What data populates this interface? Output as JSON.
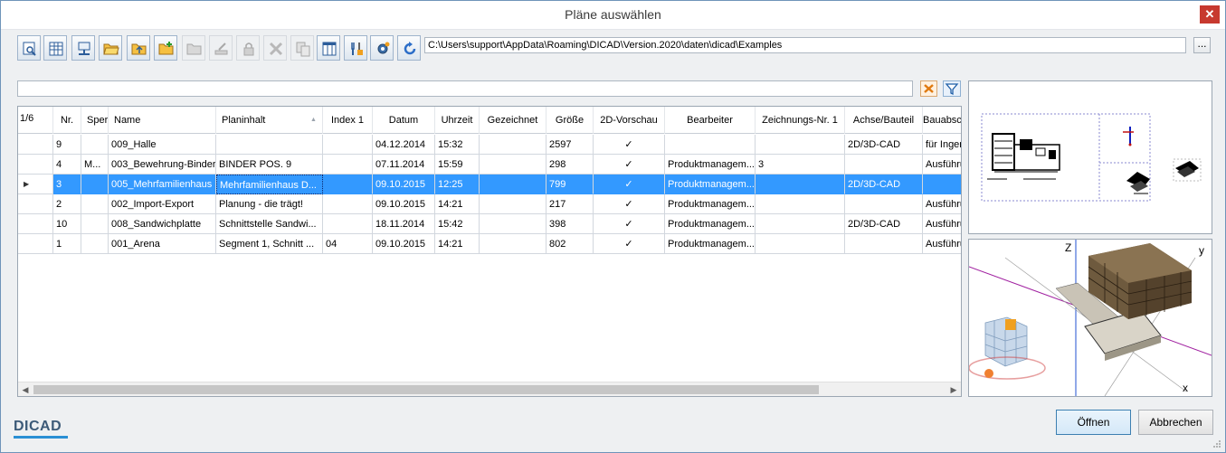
{
  "window": {
    "title": "Pläne auswählen",
    "close_label": "✕"
  },
  "toolbar": {
    "buttons": [
      {
        "icon": "preview-icon",
        "enabled": true
      },
      {
        "icon": "table-icon",
        "enabled": true
      },
      {
        "icon": "network-folder-icon",
        "enabled": true
      },
      {
        "icon": "open-folder-icon",
        "enabled": true
      },
      {
        "icon": "folder-up-icon",
        "enabled": true
      },
      {
        "icon": "new-folder-icon",
        "enabled": true
      },
      {
        "icon": "folder-open-disabled-icon",
        "enabled": false
      },
      {
        "icon": "edit-disabled-icon",
        "enabled": false
      },
      {
        "icon": "lock-disabled-icon",
        "enabled": false
      },
      {
        "icon": "delete-disabled-icon",
        "enabled": false
      },
      {
        "icon": "copy-disabled-icon",
        "enabled": false
      },
      {
        "icon": "columns-icon",
        "enabled": true
      },
      {
        "icon": "tools-icon",
        "enabled": true
      },
      {
        "icon": "settings-gear-icon",
        "enabled": true
      },
      {
        "icon": "refresh-icon",
        "enabled": true
      }
    ],
    "path": "C:\\Users\\support\\AppData\\Roaming\\DICAD\\Version.2020\\daten\\dicad\\Examples",
    "browse_label": "..."
  },
  "filter": {
    "value": ""
  },
  "grid": {
    "record_count": "1/6",
    "columns": [
      "Nr.",
      "Sperre",
      "Name",
      "Planinhalt",
      "Index 1",
      "Datum",
      "Uhrzeit",
      "Gezeichnet",
      "Größe",
      "2D-Vorschau",
      "Bearbeiter",
      "Zeichnungs-Nr. 1",
      "Achse/Bauteil",
      "Bauabschnitt"
    ],
    "sorted_column": "Planinhalt",
    "rows": [
      [
        "9",
        "",
        "009_Halle",
        "",
        "",
        "04.12.2014",
        "15:32",
        "",
        "2597",
        "✓",
        "",
        "",
        "2D/3D-CAD",
        "für Ingenieur"
      ],
      [
        "4",
        "M...",
        "003_Bewehrung-Binder",
        "BINDER POS. 9",
        "",
        "07.11.2014",
        "15:59",
        "",
        "298",
        "✓",
        "Produktmanagem...",
        "3",
        "",
        "Ausführung"
      ],
      [
        "3",
        "",
        "005_Mehrfamilienhaus",
        "Mehrfamilienhaus D...",
        "",
        "09.10.2015",
        "12:25",
        "",
        "799",
        "✓",
        "Produktmanagem...",
        "",
        "2D/3D-CAD",
        ""
      ],
      [
        "2",
        "",
        "002_Import-Export",
        "Planung - die trägt!",
        "",
        "09.10.2015",
        "14:21",
        "",
        "217",
        "✓",
        "Produktmanagem...",
        "",
        "",
        "Ausführung"
      ],
      [
        "10",
        "",
        "008_Sandwichplatte",
        "Schnittstelle Sandwi...",
        "",
        "18.11.2014",
        "15:42",
        "",
        "398",
        "✓",
        "Produktmanagem...",
        "",
        "2D/3D-CAD",
        "Ausführung"
      ],
      [
        "1",
        "",
        "001_Arena",
        "Segment 1,  Schnitt ...",
        "04",
        "09.10.2015",
        "14:21",
        "",
        "802",
        "✓",
        "Produktmanagem...",
        "",
        "",
        "Ausführung"
      ]
    ],
    "selected_row": 2
  },
  "preview3d": {
    "axis_z": "Z",
    "axis_y": "y",
    "axis_x": "x"
  },
  "footer": {
    "logo": "DICAD",
    "open_label": "Öffnen",
    "cancel_label": "Abbrechen"
  },
  "colors": {
    "selection": "#3399ff",
    "accent": "#3c7fb1",
    "logo_bar": "#2a8fd4"
  }
}
